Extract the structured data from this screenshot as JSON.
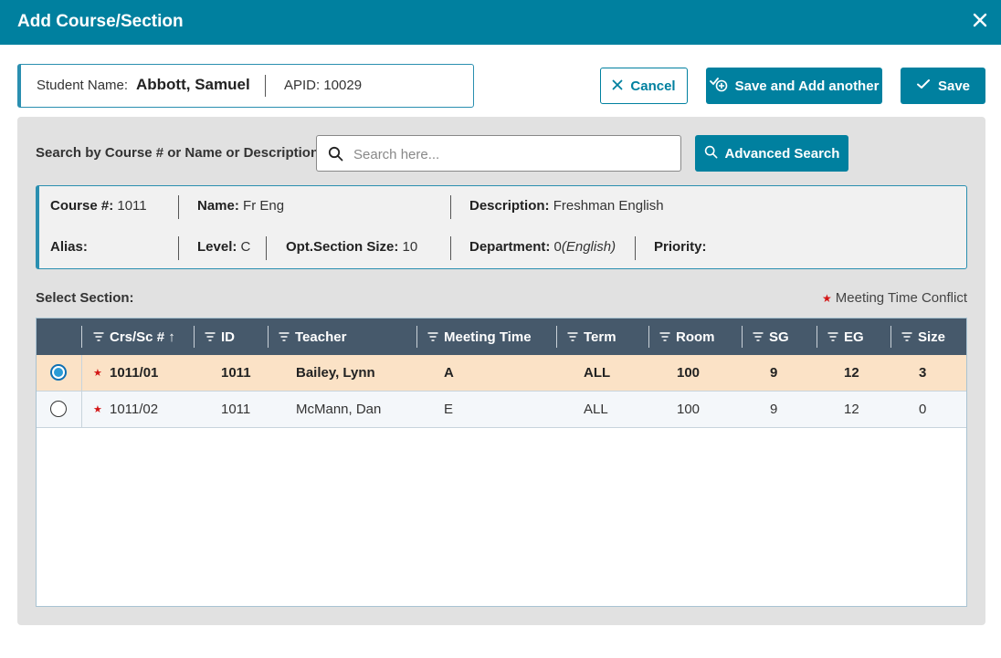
{
  "window": {
    "title": "Add Course/Section"
  },
  "student": {
    "name_label": "Student Name:",
    "name": "Abbott, Samuel",
    "apid": "APID: 10029"
  },
  "actions": {
    "cancel": "Cancel",
    "save_add": "Save and Add another",
    "save": "Save"
  },
  "search": {
    "label": "Search by Course # or Name or Description",
    "placeholder": "Search here...",
    "advanced": "Advanced Search"
  },
  "course": {
    "course_no_label": "Course #:",
    "course_no": "1011",
    "name_label": "Name:",
    "name": "Fr Eng",
    "description_label": "Description:",
    "description": "Freshman English",
    "alias_label": "Alias:",
    "level_label": "Level:",
    "level": "C",
    "opt_section_label": "Opt.Section Size:",
    "opt_section": "10",
    "department_label": "Department:",
    "department_code": "0",
    "department_name": "(English)",
    "priority_label": "Priority:"
  },
  "sections": {
    "label": "Select Section:",
    "conflict_legend": "Meeting Time Conflict",
    "columns": [
      "Crs/Sc # ↑",
      "ID",
      "Teacher",
      "Meeting Time",
      "Term",
      "Room",
      "SG",
      "EG",
      "Size"
    ],
    "rows": [
      {
        "crs": "1011/01",
        "id": "1011",
        "teacher": "Bailey, Lynn",
        "meeting": "A",
        "term": "ALL",
        "room": "100",
        "sg": "9",
        "eg": "12",
        "size": "3"
      },
      {
        "crs": "1011/02",
        "id": "1011",
        "teacher": "McMann, Dan",
        "meeting": "E",
        "term": "ALL",
        "room": "100",
        "sg": "9",
        "eg": "12",
        "size": "0"
      }
    ]
  },
  "colors": {
    "primary": "#00809f",
    "header": "#46596b",
    "selected_row": "#fbe2c6",
    "conflict": "#d31515"
  },
  "icons": [
    "close-icon",
    "x-icon",
    "add-circle-icon",
    "check-icon",
    "search-icon",
    "filter-icon",
    "radio-selected-icon",
    "radio-empty-icon",
    "star-icon"
  ]
}
